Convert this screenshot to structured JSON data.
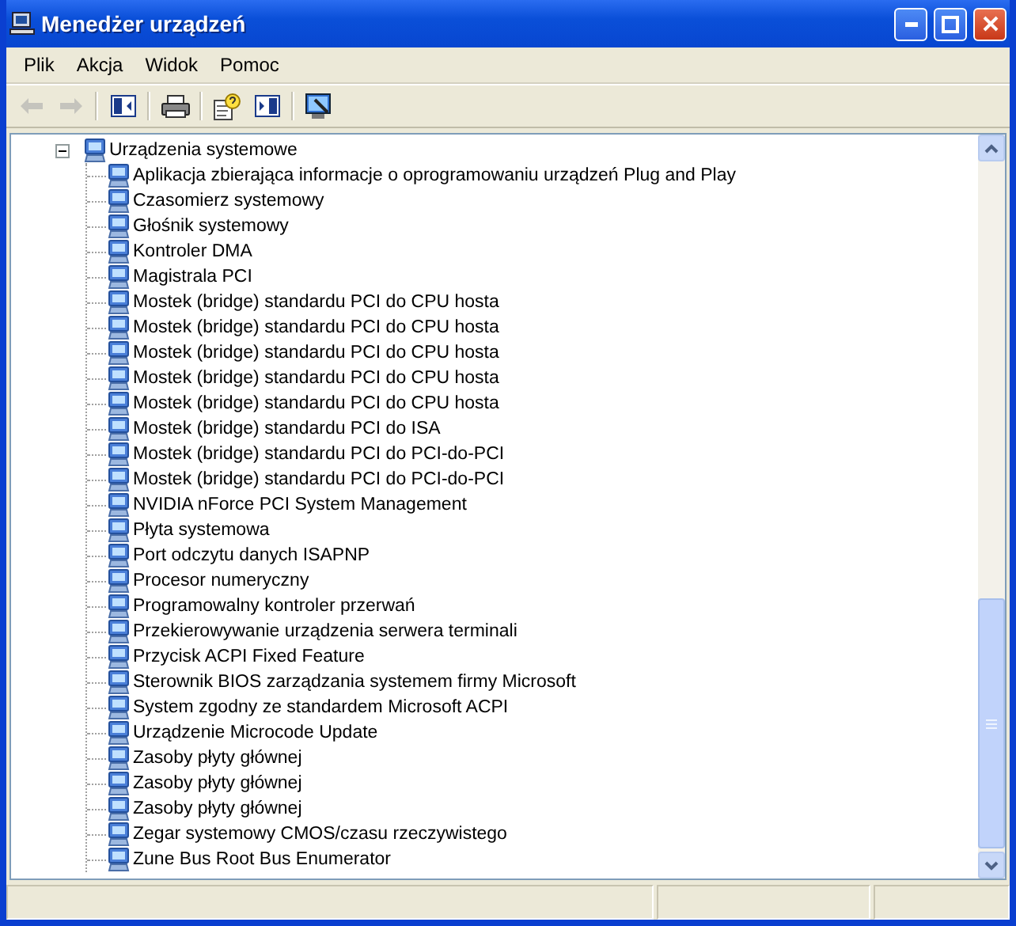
{
  "window": {
    "title": "Menedżer urządzeń"
  },
  "menu": [
    {
      "label": "Plik"
    },
    {
      "label": "Akcja"
    },
    {
      "label": "Widok"
    },
    {
      "label": "Pomoc"
    }
  ],
  "toolbar": [
    {
      "kind": "back",
      "disabled": true
    },
    {
      "kind": "forward",
      "disabled": true
    },
    {
      "kind": "sep"
    },
    {
      "kind": "tree",
      "disabled": false
    },
    {
      "kind": "sep"
    },
    {
      "kind": "print",
      "disabled": false
    },
    {
      "kind": "sep"
    },
    {
      "kind": "help",
      "disabled": false
    },
    {
      "kind": "pane",
      "disabled": false
    },
    {
      "kind": "sep"
    },
    {
      "kind": "scan",
      "disabled": false
    }
  ],
  "tree": {
    "label": "Urządzenia systemowe",
    "expanded": true,
    "children": [
      {
        "label": "Aplikacja zbierająca informacje o oprogramowaniu urządzeń Plug and Play"
      },
      {
        "label": "Czasomierz systemowy"
      },
      {
        "label": "Głośnik systemowy"
      },
      {
        "label": "Kontroler DMA"
      },
      {
        "label": "Magistrala PCI"
      },
      {
        "label": "Mostek (bridge) standardu PCI do CPU hosta"
      },
      {
        "label": "Mostek (bridge) standardu PCI do CPU hosta"
      },
      {
        "label": "Mostek (bridge) standardu PCI do CPU hosta"
      },
      {
        "label": "Mostek (bridge) standardu PCI do CPU hosta"
      },
      {
        "label": "Mostek (bridge) standardu PCI do CPU hosta"
      },
      {
        "label": "Mostek (bridge) standardu PCI do ISA"
      },
      {
        "label": "Mostek (bridge) standardu PCI do PCI-do-PCI"
      },
      {
        "label": "Mostek (bridge) standardu PCI do PCI-do-PCI"
      },
      {
        "label": "NVIDIA nForce PCI System Management"
      },
      {
        "label": "Płyta systemowa"
      },
      {
        "label": "Port odczytu danych ISAPNP"
      },
      {
        "label": "Procesor numeryczny"
      },
      {
        "label": "Programowalny kontroler przerwań"
      },
      {
        "label": "Przekierowywanie urządzenia serwera terminali"
      },
      {
        "label": "Przycisk ACPI Fixed Feature"
      },
      {
        "label": "Sterownik BIOS zarządzania systemem firmy Microsoft"
      },
      {
        "label": "System zgodny ze standardem Microsoft ACPI"
      },
      {
        "label": "Urządzenie Microcode Update"
      },
      {
        "label": "Zasoby płyty głównej"
      },
      {
        "label": "Zasoby płyty głównej"
      },
      {
        "label": "Zasoby płyty głównej"
      },
      {
        "label": "Zegar systemowy CMOS/czasu rzeczywistego"
      },
      {
        "label": "Zune Bus Root Bus Enumerator"
      }
    ]
  }
}
